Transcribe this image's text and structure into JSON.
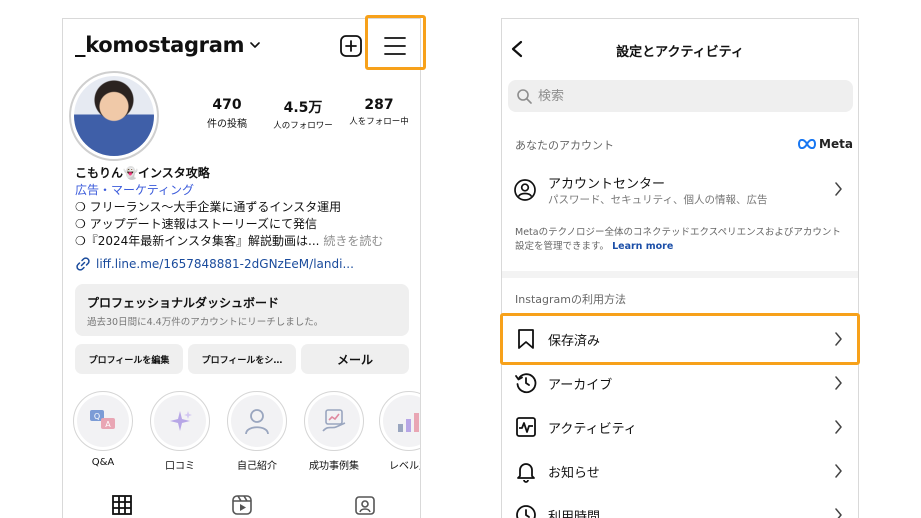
{
  "profile": {
    "username": "_komostagram",
    "stats": [
      {
        "value": "470",
        "label": "件の投稿"
      },
      {
        "value": "4.5万",
        "label": "人のフォロワー"
      },
      {
        "value": "287",
        "label": "人をフォロー中"
      }
    ],
    "bio": {
      "name": "こもりん👻インスタ攻略",
      "category": "広告・マーケティング",
      "lines": [
        "❍ フリーランス〜大手企業に通ずるインスタ運用",
        "❍ アップデート速報はストーリーズにて発信",
        "❍『2024年最新インスタ集客』解説動画は..."
      ],
      "more": " 続きを読む",
      "link": "liff.line.me/1657848881-2dGNzEeM/landi..."
    },
    "dashboard": {
      "title": "プロフェッショナルダッシュボード",
      "subtitle": "過去30日間に4.4万件のアカウントにリーチしました。"
    },
    "buttons": {
      "edit": "プロフィールを編集",
      "share": "プロフィールをシ…",
      "mail": "メール"
    },
    "highlights": [
      {
        "label": "Q&A",
        "icon": "qa-icon"
      },
      {
        "label": "口コミ",
        "icon": "sparkle-icon"
      },
      {
        "label": "自己紹介",
        "icon": "person-icon"
      },
      {
        "label": "成功事例集",
        "icon": "success-icon"
      },
      {
        "label": "レベル別",
        "icon": "chart-icon"
      }
    ]
  },
  "settings": {
    "title": "設定とアクティビティ",
    "search_placeholder": "検索",
    "your_account_heading": "あなたのアカウント",
    "meta_logo": "Meta",
    "account_center": {
      "title": "アカウントセンター",
      "subtitle": "パスワード、セキュリティ、個人の情報、広告"
    },
    "meta_note": "Metaのテクノロジー全体のコネクテッドエクスペリエンスおよびアカウント設定を管理できます。",
    "learn_more": "Learn more",
    "usage_heading": "Instagramの利用方法",
    "items": [
      {
        "label": "保存済み",
        "icon": "bookmark-icon"
      },
      {
        "label": "アーカイブ",
        "icon": "archive-icon"
      },
      {
        "label": "アクティビティ",
        "icon": "activity-icon"
      },
      {
        "label": "お知らせ",
        "icon": "bell-icon"
      },
      {
        "label": "利用時間",
        "icon": "clock-icon"
      }
    ]
  },
  "accent": {
    "highlight_border": "#f7a11a",
    "link": "#1c4fa8"
  }
}
